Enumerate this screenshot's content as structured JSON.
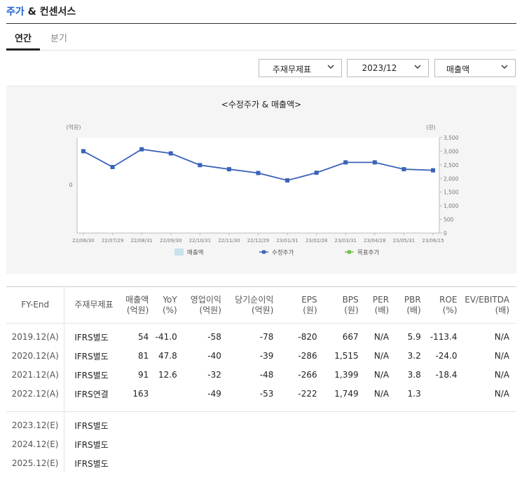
{
  "header": {
    "title_accent": "주가",
    "title_rest": " & 컨센서스"
  },
  "tabs": [
    {
      "label": "연간"
    },
    {
      "label": "분기"
    }
  ],
  "selects": {
    "statement": "주재무제표",
    "period": "2023/12",
    "metric": "매출액"
  },
  "chart_data": {
    "type": "line",
    "title": "<수정주가 & 매출액>",
    "left_axis_unit": "(억원)",
    "right_axis_unit": "(원)",
    "left_ticks": [
      "0"
    ],
    "right_ticks": [
      "0",
      "500",
      "1,000",
      "1,500",
      "2,000",
      "2,500",
      "3,000",
      "3,500"
    ],
    "right_ylim": [
      0,
      3500
    ],
    "x": [
      "22/06/30",
      "22/07/29",
      "22/08/31",
      "22/09/30",
      "22/10/31",
      "22/11/30",
      "22/12/29",
      "23/01/31",
      "23/02/28",
      "23/03/31",
      "23/04/28",
      "23/05/31",
      "23/06/15"
    ],
    "series": [
      {
        "name": "수정주가",
        "color": "#3a63b8",
        "values": [
          3000,
          2420,
          3070,
          2920,
          2490,
          2340,
          2200,
          1930,
          2210,
          2590,
          2590,
          2340,
          2300
        ]
      }
    ],
    "legend": [
      {
        "name": "매출액",
        "kind": "box",
        "color": "#c8e2ec"
      },
      {
        "name": "수정주가",
        "kind": "line-square",
        "color": "#3a63b8"
      },
      {
        "name": "목표주가",
        "kind": "line-square",
        "color": "#6cc04a"
      }
    ]
  },
  "table": {
    "headers": [
      {
        "l1": "FY-End",
        "l2": ""
      },
      {
        "l1": "주재무제표",
        "l2": ""
      },
      {
        "l1": "매출액",
        "l2": "(억원)"
      },
      {
        "l1": "YoY",
        "l2": "(%)"
      },
      {
        "l1": "영업이익",
        "l2": "(억원)"
      },
      {
        "l1": "당기순이익",
        "l2": "(억원)"
      },
      {
        "l1": "EPS",
        "l2": "(원)"
      },
      {
        "l1": "BPS",
        "l2": "(원)"
      },
      {
        "l1": "PER",
        "l2": "(배)"
      },
      {
        "l1": "PBR",
        "l2": "(배)"
      },
      {
        "l1": "ROE",
        "l2": "(%)"
      },
      {
        "l1": "EV/EBITDA",
        "l2": "(배)"
      }
    ],
    "actual_rows": [
      {
        "fy": "2019.12(A)",
        "std": "IFRS별도",
        "sales": "54",
        "yoy": "-41.0",
        "op": "-58",
        "net": "-78",
        "eps": "-820",
        "bps": "667",
        "per": "N/A",
        "pbr": "5.9",
        "roe": "-113.4",
        "ev": "N/A"
      },
      {
        "fy": "2020.12(A)",
        "std": "IFRS별도",
        "sales": "81",
        "yoy": "47.8",
        "op": "-40",
        "net": "-39",
        "eps": "-286",
        "bps": "1,515",
        "per": "N/A",
        "pbr": "3.2",
        "roe": "-24.0",
        "ev": "N/A"
      },
      {
        "fy": "2021.12(A)",
        "std": "IFRS별도",
        "sales": "91",
        "yoy": "12.6",
        "op": "-32",
        "net": "-48",
        "eps": "-266",
        "bps": "1,399",
        "per": "N/A",
        "pbr": "3.8",
        "roe": "-18.4",
        "ev": "N/A"
      },
      {
        "fy": "2022.12(A)",
        "std": "IFRS연결",
        "sales": "163",
        "yoy": "",
        "op": "-49",
        "net": "-53",
        "eps": "-222",
        "bps": "1,749",
        "per": "N/A",
        "pbr": "1.3",
        "roe": "",
        "ev": "N/A"
      }
    ],
    "estimate_rows": [
      {
        "fy": "2023.12(E)",
        "std": "IFRS별도"
      },
      {
        "fy": "2024.12(E)",
        "std": "IFRS별도"
      },
      {
        "fy": "2025.12(E)",
        "std": "IFRS별도"
      }
    ]
  }
}
